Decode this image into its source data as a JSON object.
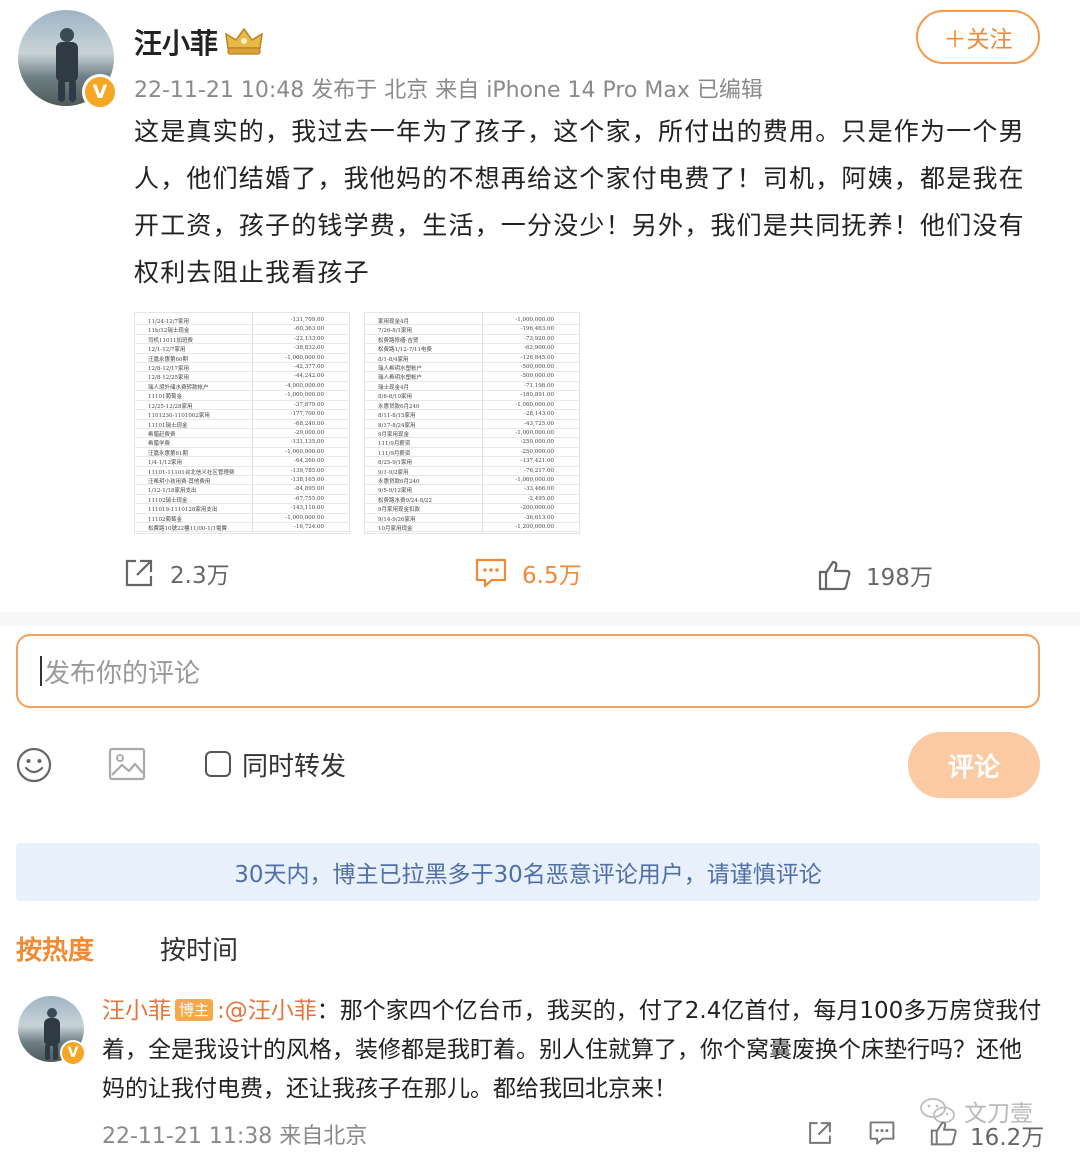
{
  "post": {
    "username": "汪小菲",
    "verified_badge": "V",
    "meta": "22-11-21 10:48 发布于 北京 来自 iPhone 14 Pro Max 已编辑",
    "follow_label": "＋关注",
    "text": "这是真实的，我过去一年为了孩子，这个家，所付出的费用。只是作为一个男人，他们结婚了，我他妈的不想再给这个家付电费了！司机，阿姨，都是我在开工资，孩子的钱学费，生活，一分没少！另外，我们是共同抚养！他们没有权利去阻止我看孩子",
    "images": [
      {
        "rows": [
          [
            "11/24-12/7家用",
            "-131,709.00"
          ],
          [
            "11b/12瑞士现金",
            "-60,363.00"
          ],
          [
            "司机11011加班费",
            "-22,133.00"
          ],
          [
            "12/1-12/7家用",
            "-38,832.00"
          ],
          [
            "汪嘉永惠第60期",
            "-1,060,000.00"
          ],
          [
            "12/8-12/17家用",
            "-42,377.00"
          ],
          [
            "12/8-12/25家用",
            "-44,242.00"
          ],
          [
            "瑞人境外储水费转款帐户",
            "-4,000,000.00"
          ],
          [
            "11101葡萄金",
            "-1,000,000.00"
          ],
          [
            "12/25-12/28家用",
            "-37,879.00"
          ],
          [
            "1101230-1101002家用",
            "-177,700.00"
          ],
          [
            "11101瑞士现金",
            "-68,240.00"
          ],
          [
            "希腊赶费费",
            "-29,000.00"
          ],
          [
            "希腊学费",
            "-131,135.00"
          ],
          [
            "汪嘉永惠第61期",
            "-1,060,000.00"
          ],
          [
            "1/4-1/12家用",
            "-64,260.00"
          ],
          [
            "11101-11101台北信义社区管理费",
            "-139,785.00"
          ],
          [
            "汪希玥小孩用费-其他费用",
            "-138,165.00"
          ],
          [
            "1/12-1/18家用支出",
            "-84,895.00"
          ],
          [
            "11102瑞士现金",
            "-67,755.00"
          ],
          [
            "111019-1110128家用支出",
            "-143,110.00"
          ],
          [
            "11102葡萄金",
            "-1,000,000.00"
          ],
          [
            "松費路10號22樓11/00-1/1電費",
            "-16,724.00"
          ]
        ]
      },
      {
        "rows": [
          [
            "家用现金4月",
            "-1,000,000.00"
          ],
          [
            "7/26-8/1家用",
            "-196,463.00"
          ],
          [
            "松费路修缮-吉贤",
            "-73,920.00"
          ],
          [
            "松费路1/12-7/11电费",
            "-62,900.00"
          ],
          [
            "8/1-8/4家用",
            "-126,845.00"
          ],
          [
            "瑞人希玥水塑帐户",
            "-500,000.00"
          ],
          [
            "瑞人希玥水塑帐户",
            "-500,000.00"
          ],
          [
            "瑞士现金4月",
            "-71,198.00"
          ],
          [
            "8/8-8/10家用",
            "-180,891.00"
          ],
          [
            "永惠贷款6月240",
            "-1,060,000.00"
          ],
          [
            "8/11-8/15家用",
            "-28,143.00"
          ],
          [
            "8/17-8/24家用",
            "-43,725.00"
          ],
          [
            "9月家用现金",
            "-1,000,000.00"
          ],
          [
            "111/9月薪资",
            "-250,000.00"
          ],
          [
            "111/9月薪资",
            "-250,000.00"
          ],
          [
            "8/25-9/1家用",
            "-137,421.00"
          ],
          [
            "9/1-9/2家用",
            "-76,217.00"
          ],
          [
            "永惠贷款6月240",
            "-1,060,000.00"
          ],
          [
            "9/5-9/12家用",
            "-33,466.00"
          ],
          [
            "松费路水费9/24-8/22",
            "-2,495.00"
          ],
          [
            "9月家用现金扣款",
            "-200,000.00"
          ],
          [
            "9/14-9/26家用",
            "-36,613.00"
          ],
          [
            "10月家用现金",
            "-1,200,000.00"
          ]
        ]
      }
    ],
    "actions": {
      "repost": "2.3万",
      "comments": "6.5万",
      "likes": "198万"
    },
    "colors": {
      "accent": "#f08a35",
      "comment_active": "#f08a35"
    }
  },
  "composer": {
    "placeholder": "发布你的评论",
    "emoji_icon": "smiley-icon",
    "image_icon": "image-icon",
    "repost_checkbox_label": "同时转发",
    "submit_label": "评论"
  },
  "notice": "30天内，博主已拉黑多于30名恶意评论用户，请谨慎评论",
  "sort": {
    "hot": "按热度",
    "time": "按时间"
  },
  "comment": {
    "username": "汪小菲",
    "tag": "博主",
    "mention": ":@汪小菲",
    "text": "：那个家四个亿台币，我买的，付了2.4亿首付，每月100多万房贷我付着，全是我设计的风格，装修都是我盯着。别人住就算了，你个窝囊废换个床垫行吗？还他妈的让我付电费，还让我孩子在那儿。都给我回北京来！",
    "meta": "22-11-21 11:38 来自北京",
    "likes": "16.2万",
    "verified_badge": "V"
  },
  "watermark": "文刀壹"
}
